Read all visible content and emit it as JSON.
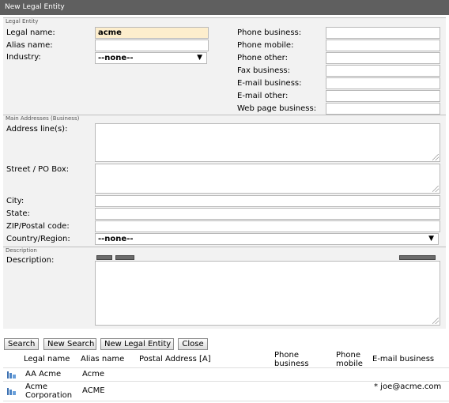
{
  "window": {
    "title": "New Legal Entity"
  },
  "sections": {
    "legal_entity": "Legal Entity",
    "main_addresses": "Main Addresses (Business)",
    "description": "Description"
  },
  "left_fields": {
    "legal_name": {
      "label": "Legal name:",
      "value": "acme"
    },
    "alias_name": {
      "label": "Alias name:",
      "value": ""
    },
    "industry": {
      "label": "Industry:",
      "value": "--none--"
    }
  },
  "right_fields": {
    "phone_business": {
      "label": "Phone business:",
      "value": ""
    },
    "phone_mobile": {
      "label": "Phone mobile:",
      "value": ""
    },
    "phone_other": {
      "label": "Phone other:",
      "value": ""
    },
    "fax_business": {
      "label": "Fax business:",
      "value": ""
    },
    "email_business": {
      "label": "E-mail business:",
      "value": ""
    },
    "email_other": {
      "label": "E-mail other:",
      "value": ""
    },
    "web_page_business": {
      "label": "Web page business:",
      "value": ""
    }
  },
  "address": {
    "address_lines": {
      "label": "Address line(s):",
      "value": ""
    },
    "street": {
      "label": "Street / PO Box:",
      "value": ""
    },
    "city": {
      "label": "City:",
      "value": ""
    },
    "state": {
      "label": "State:",
      "value": ""
    },
    "zip": {
      "label": "ZIP/Postal code:",
      "value": ""
    },
    "country": {
      "label": "Country/Region:",
      "value": "--none--"
    }
  },
  "description": {
    "label": "Description:",
    "value": ""
  },
  "buttons": {
    "search": "Search",
    "new_search": "New Search",
    "new_legal_entity": "New Legal Entity",
    "close": "Close"
  },
  "results": {
    "columns": {
      "legal_name": "Legal name",
      "alias_name": "Alias name",
      "postal_address": "Postal Address [A]",
      "phone_business": "Phone business",
      "phone_mobile": "Phone mobile",
      "email_business": "E-mail business"
    },
    "rows": [
      {
        "legal_name": "AA Acme",
        "alias_name": "Acme",
        "postal_address": "",
        "phone_business": "",
        "phone_mobile": "",
        "email_business": ""
      },
      {
        "legal_name": "Acme Corporation",
        "alias_name": "ACME",
        "postal_address": "",
        "phone_business": "",
        "phone_mobile": "",
        "email_business": "* joe@acme.com"
      }
    ]
  },
  "icons": {
    "row_icon": "legal-entity-icon",
    "select_arrow": "chevron-down-icon",
    "resize_grip": "resize-grip-icon"
  }
}
